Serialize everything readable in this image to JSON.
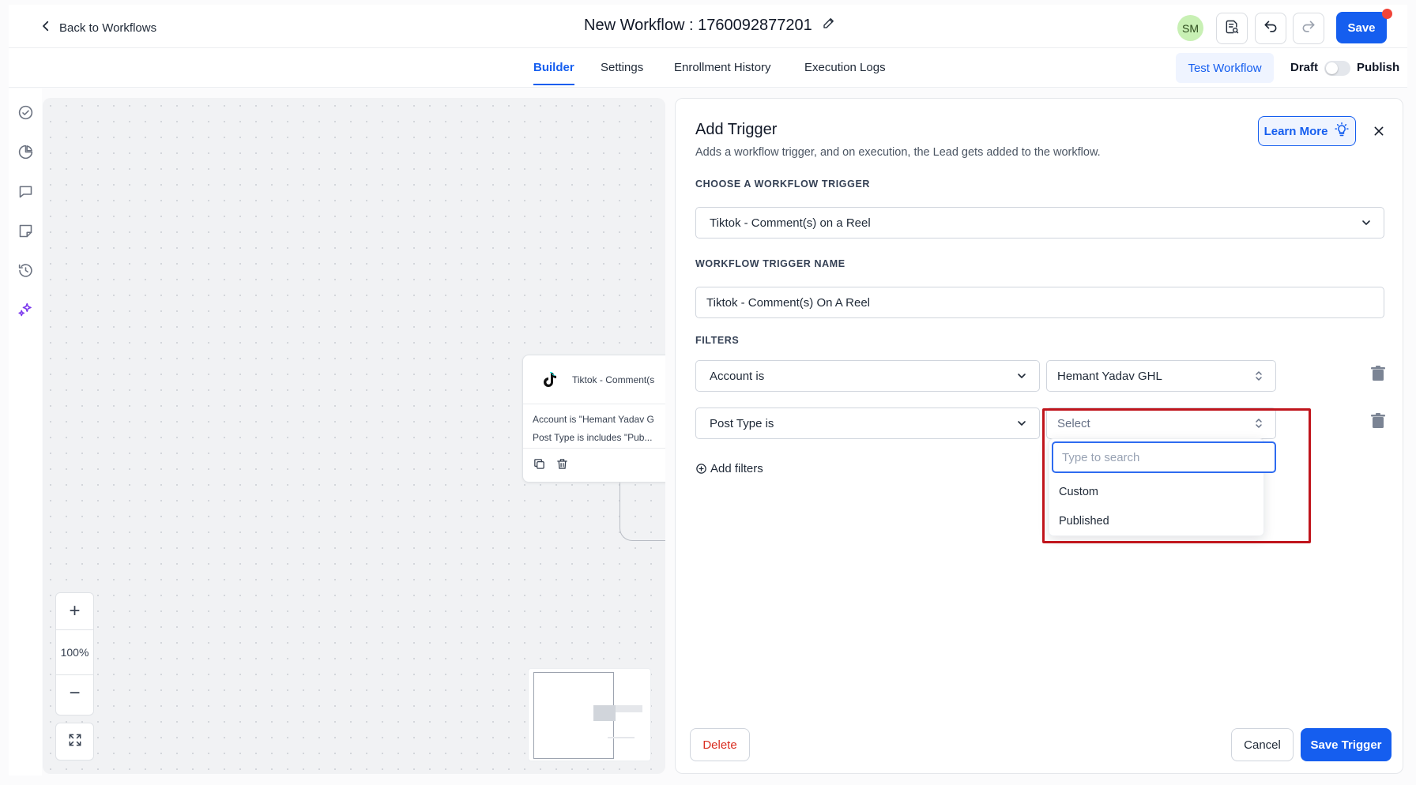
{
  "header": {
    "back_label": "Back to Workflows",
    "title": "New Workflow : 1760092877201",
    "avatar_initials": "SM",
    "save_label": "Save"
  },
  "tabs": [
    {
      "label": "Builder",
      "active": true
    },
    {
      "label": "Settings",
      "active": false
    },
    {
      "label": "Enrollment History",
      "active": false
    },
    {
      "label": "Execution Logs",
      "active": false
    }
  ],
  "tabs_right": {
    "test_label": "Test Workflow",
    "draft_label": "Draft",
    "publish_label": "Publish",
    "published": false
  },
  "rail_icons": [
    "check-circle-icon",
    "pie-chart-icon",
    "comment-icon",
    "note-icon",
    "history-icon",
    "sparkle-icon"
  ],
  "canvas": {
    "node": {
      "title": "Tiktok - Comment(s",
      "line1": "Account is \"Hemant Yadav G",
      "line2": "Post Type is includes \"Pub..."
    },
    "zoom_level": "100%",
    "zoom_in": "+",
    "zoom_out": "−"
  },
  "panel": {
    "title": "Add Trigger",
    "subtitle": "Adds a workflow trigger, and on execution, the Lead gets added to the workflow.",
    "learn_more": "Learn More",
    "choose_label": "CHOOSE A WORKFLOW TRIGGER",
    "trigger_value": "Tiktok - Comment(s) on a Reel",
    "name_label": "WORKFLOW TRIGGER NAME",
    "name_value": "Tiktok - Comment(s) On A Reel",
    "filters_label": "FILTERS",
    "filters": [
      {
        "field": "Account is",
        "value": "Hemant Yadav GHL"
      },
      {
        "field": "Post Type is",
        "value": "Select"
      }
    ],
    "add_filters": "Add filters",
    "delete_label": "Delete",
    "cancel_label": "Cancel",
    "save_trigger_label": "Save Trigger"
  },
  "dropdown": {
    "search_placeholder": "Type to search",
    "options": [
      "Custom",
      "Published"
    ]
  },
  "colors": {
    "accent": "#155eef",
    "highlight": "#c0151c",
    "danger": "#d92d20"
  }
}
